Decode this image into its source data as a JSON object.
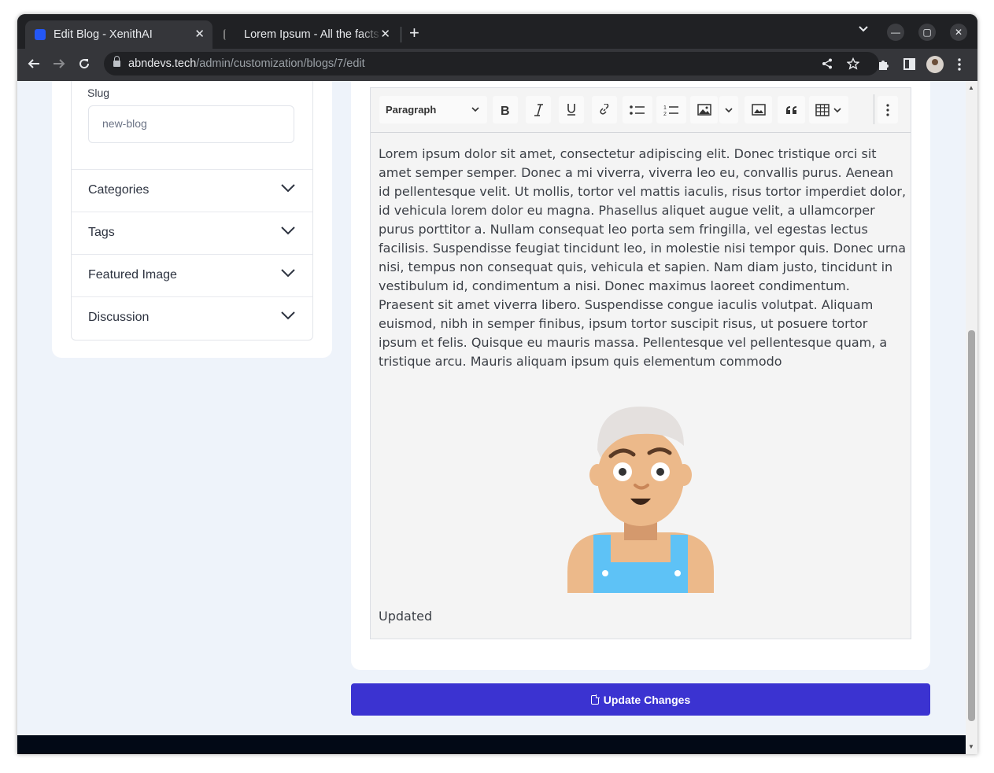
{
  "browser": {
    "tabs": [
      {
        "title": "Edit Blog - XenithAI",
        "active": true
      },
      {
        "title": "Lorem Ipsum - All the facts - Lipsum generator",
        "active": false
      }
    ],
    "url_host": "abndevs.tech",
    "url_path": "/admin/customization/blogs/7/edit"
  },
  "sidebar": {
    "slug_label": "Slug",
    "slug_value": "new-blog",
    "sections": [
      {
        "label": "Categories"
      },
      {
        "label": "Tags"
      },
      {
        "label": "Featured Image"
      },
      {
        "label": "Discussion"
      }
    ]
  },
  "editor": {
    "paragraph_label": "Paragraph",
    "content": "Lorem ipsum dolor sit amet, consectetur adipiscing elit. Donec tristique orci sit amet semper semper. Donec a mi viverra, viverra leo eu, convallis purus. Aenean id pellentesque velit. Ut mollis, tortor vel mattis iaculis, risus tortor imperdiet dolor, id vehicula lorem dolor eu magna. Phasellus aliquet augue velit, a ullamcorper purus porttitor a. Nullam consequat leo porta sem fringilla, vel egestas lectus facilisis. Suspendisse feugiat tincidunt leo, in molestie nisi tempor quis. Donec urna nisi, tempus non consequat quis, vehicula et sapien. Nam diam justo, tincidunt in vestibulum id, condimentum a nisi. Donec maximus laoreet condimentum. Praesent sit amet viverra libero. Suspendisse congue iaculis volutpat. Aliquam euismod, nibh in semper finibus, ipsum tortor suscipit risus, ut posuere tortor ipsum et felis. Quisque eu mauris massa. Pellentesque vel pellentesque quam, a tristique arcu. Mauris aliquam ipsum quis elementum commodo",
    "caption": "Updated"
  },
  "actions": {
    "update_label": "Update Changes"
  },
  "colors": {
    "primary": "#3b33d1",
    "page_bg": "#eef3fa",
    "footer": "#020916"
  }
}
